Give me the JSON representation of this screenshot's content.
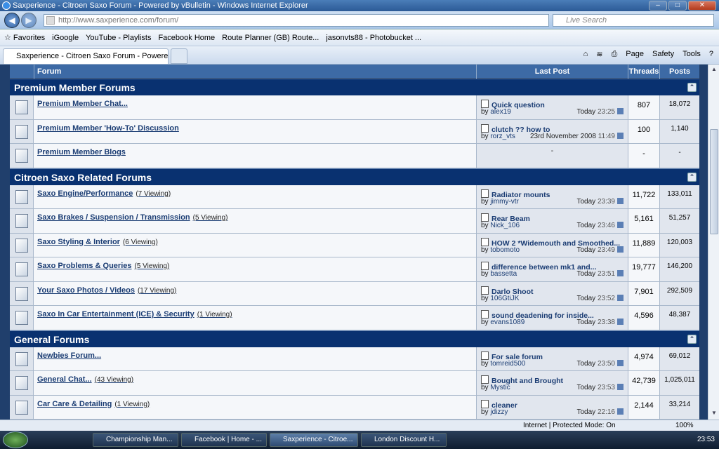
{
  "window": {
    "title": "Saxperience - Citroen Saxo Forum - Powered by vBulletin - Windows Internet Explorer"
  },
  "address": {
    "url": "http://www.saxperience.com/forum/",
    "search_placeholder": "Live Search"
  },
  "favorites": {
    "label": "Favorites",
    "items": [
      "iGoogle",
      "YouTube - Playlists",
      "Facebook  Home",
      "Route Planner (GB)  Route...",
      "jasonvts88 - Photobucket ..."
    ]
  },
  "tab": {
    "label": "Saxperience - Citroen Saxo Forum - Powered by v..."
  },
  "toolbar": {
    "page": "Page",
    "safety": "Safety",
    "tools": "Tools"
  },
  "columns": {
    "forum": "Forum",
    "last_post": "Last Post",
    "threads": "Threads",
    "posts": "Posts"
  },
  "categories": [
    {
      "name": "Premium Member Forums",
      "forums": [
        {
          "name": "Premium Member Chat...",
          "viewing": "",
          "title": "Quick question",
          "by": "alex19",
          "date": "Today",
          "time": "23:25",
          "threads": "807",
          "posts": "18,072"
        },
        {
          "name": "Premium Member 'How-To' Discussion",
          "viewing": "",
          "title": "clutch ?? how to",
          "by": "rorz_vts",
          "date": "23rd November 2008",
          "time": "11:49",
          "threads": "100",
          "posts": "1,140"
        },
        {
          "name": "Premium Member Blogs",
          "viewing": "",
          "title": "",
          "by": "",
          "date": "",
          "time": "",
          "threads": "-",
          "posts": "-",
          "empty": "-"
        }
      ]
    },
    {
      "name": "Citroen Saxo Related Forums",
      "forums": [
        {
          "name": "Saxo Engine/Performance",
          "viewing": "(7 Viewing)",
          "title": "Radiator mounts",
          "by": "jimmy-vtr",
          "date": "Today",
          "time": "23:39",
          "threads": "11,722",
          "posts": "133,011"
        },
        {
          "name": "Saxo Brakes / Suspension / Transmission",
          "viewing": "(5 Viewing)",
          "title": "Rear Beam",
          "by": "Nick_106",
          "date": "Today",
          "time": "23:46",
          "threads": "5,161",
          "posts": "51,257"
        },
        {
          "name": "Saxo Styling & Interior",
          "viewing": "(6 Viewing)",
          "title": "HOW 2 *Widemouth and Smoothed...",
          "by": "tobomoto",
          "date": "Today",
          "time": "23:49",
          "threads": "11,889",
          "posts": "120,003"
        },
        {
          "name": "Saxo Problems & Queries",
          "viewing": "(5 Viewing)",
          "title": "difference between mk1 and...",
          "by": "bassetta",
          "date": "Today",
          "time": "23:51",
          "threads": "19,777",
          "posts": "146,200"
        },
        {
          "name": "Your Saxo Photos / Videos",
          "viewing": "(17 Viewing)",
          "title": "Darlo Shoot",
          "by": "106GtiJK",
          "date": "Today",
          "time": "23:52",
          "threads": "7,901",
          "posts": "292,509"
        },
        {
          "name": "Saxo In Car Entertainment (ICE) & Security",
          "viewing": "(1 Viewing)",
          "title": "sound deadening for inside...",
          "by": "evans1089",
          "date": "Today",
          "time": "23:38",
          "threads": "4,596",
          "posts": "48,387"
        }
      ]
    },
    {
      "name": "General Forums",
      "forums": [
        {
          "name": "Newbies Forum...",
          "viewing": "",
          "title": "For sale forum",
          "by": "tomreid500",
          "date": "Today",
          "time": "23:50",
          "threads": "4,974",
          "posts": "69,012"
        },
        {
          "name": "General Chat...",
          "viewing": "(43 Viewing)",
          "title": "Bought and Brought",
          "by": "Mystic",
          "date": "Today",
          "time": "23:53",
          "threads": "42,739",
          "posts": "1,025,011"
        },
        {
          "name": "Car Care & Detailing",
          "viewing": "(1 Viewing)",
          "title": "cleaner",
          "by": "jdizzy",
          "date": "Today",
          "time": "22:16",
          "threads": "2,144",
          "posts": "33,214"
        }
      ]
    }
  ],
  "status": {
    "zone": "Internet | Protected Mode: On",
    "zoom": "100%"
  },
  "taskbar": {
    "items": [
      "Championship Man...",
      "Facebook | Home - ...",
      "Saxperience - Citroe...",
      "London Discount H..."
    ],
    "clock": "23:53"
  }
}
